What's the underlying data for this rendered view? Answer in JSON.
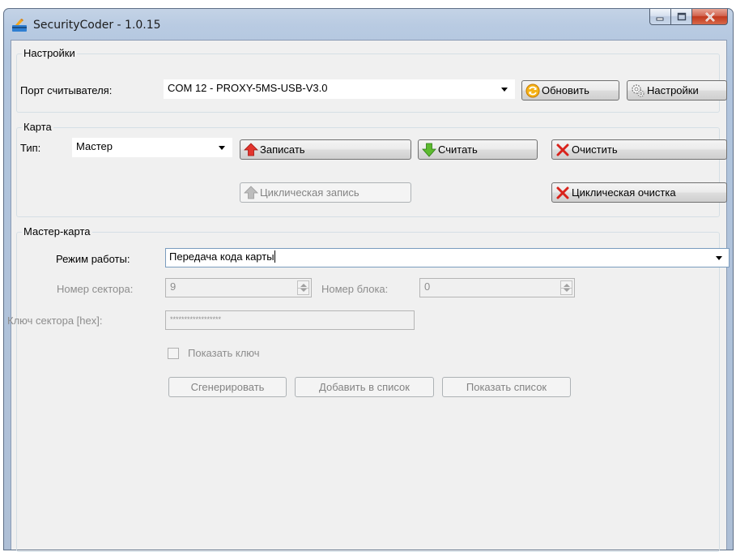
{
  "window": {
    "title": "SecurityCoder - 1.0.15",
    "colors": {
      "frame": "#b9cbe2",
      "close": "#c1381c",
      "client": "#f0f0f0"
    }
  },
  "settings": {
    "group_title": "Настройки",
    "port_label": "Порт считывателя:",
    "port_value": "COM 12 - PROXY-5MS-USB-V3.0",
    "refresh_label": "Обновить",
    "settings_label": "Настройки",
    "icons": [
      "refresh-icon",
      "gear-icon"
    ]
  },
  "card": {
    "group_title": "Карта",
    "type_label": "Тип:",
    "type_value": "Мастер",
    "write_label": "Записать",
    "read_label": "Считать",
    "clear_label": "Очистить",
    "cyclic_write_label": "Циклическая запись",
    "cyclic_clear_label": "Циклическая очистка",
    "icons": [
      "arrow-up-icon",
      "arrow-down-icon",
      "cross-icon"
    ]
  },
  "master": {
    "group_title": "Мастер-карта",
    "mode_label": "Режим работы:",
    "mode_value": "Передача кода карты",
    "sector_label": "Номер сектора:",
    "sector_value": "9",
    "block_label": "Номер блока:",
    "block_value": "0",
    "key_label": "Ключ сектора [hex]:",
    "key_value": "******************",
    "show_key_label": "Показать ключ",
    "generate_label": "Сгенерировать",
    "add_label": "Добавить в список",
    "show_list_label": "Показать список"
  }
}
